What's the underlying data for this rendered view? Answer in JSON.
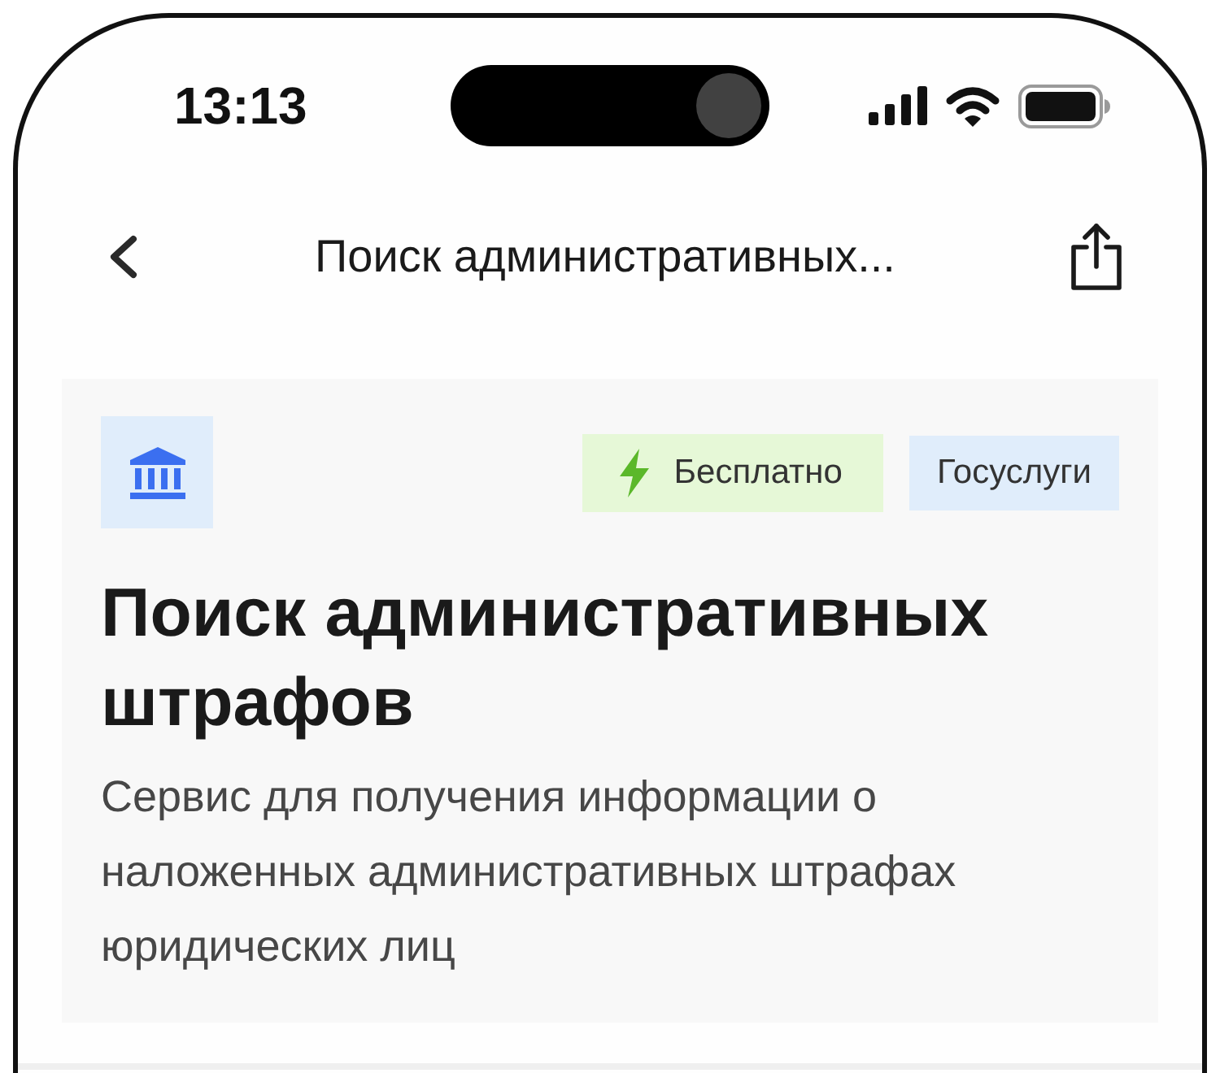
{
  "status_bar": {
    "time": "13:13"
  },
  "nav_bar": {
    "title": "Поиск административных..."
  },
  "service_card": {
    "badges": [
      {
        "kind": "free",
        "label": "Бесплатно",
        "color": "#e6f8d7"
      },
      {
        "kind": "provider",
        "label": "Госуслуги",
        "color": "#e0edfb"
      }
    ],
    "title": "Поиск административных штрафов",
    "description": "Сервис для получения информации о наложенных административных штрафах юридических лиц"
  }
}
